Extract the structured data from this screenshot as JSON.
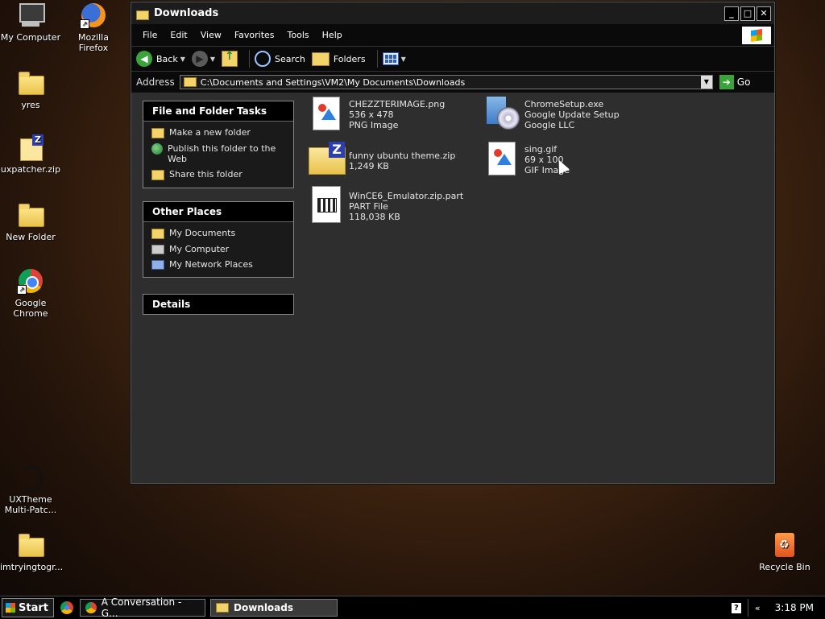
{
  "desktop": {
    "icons": [
      {
        "label": "My Computer"
      },
      {
        "label": "Mozilla Firefox"
      },
      {
        "label": "yres"
      },
      {
        "label": "uxpatcher.zip"
      },
      {
        "label": "New Folder"
      },
      {
        "label": "Google Chrome"
      },
      {
        "label": "UXTheme Multi-Patc..."
      },
      {
        "label": "imtryingtogr..."
      },
      {
        "label": "Recycle Bin"
      }
    ]
  },
  "window": {
    "title": "Downloads",
    "buttons": {
      "minimize": "_",
      "maximize": "□",
      "close": "✕"
    },
    "menu": [
      "File",
      "Edit",
      "View",
      "Favorites",
      "Tools",
      "Help"
    ],
    "toolbar": {
      "back": "Back",
      "search": "Search",
      "folders": "Folders"
    },
    "address": {
      "label": "Address",
      "path": "C:\\Documents and Settings\\VM2\\My Documents\\Downloads",
      "go": "Go"
    }
  },
  "tasks": {
    "file_folder": {
      "title": "File and Folder Tasks",
      "items": [
        "Make a new folder",
        "Publish this folder to the Web",
        "Share this folder"
      ]
    },
    "other_places": {
      "title": "Other Places",
      "items": [
        "My Documents",
        "My Computer",
        "My Network Places"
      ]
    },
    "details": {
      "title": "Details"
    }
  },
  "files": [
    {
      "name": "CHEZZTERIMAGE.png",
      "line2": "536 x 478",
      "line3": "PNG Image",
      "icon": "image-file-icon"
    },
    {
      "name": "ChromeSetup.exe",
      "line2": "Google Update Setup",
      "line3": "Google LLC",
      "icon": "installer-icon"
    },
    {
      "name": "funny ubuntu theme.zip",
      "line2": "1,249 KB",
      "line3": "",
      "icon": "zip-icon"
    },
    {
      "name": "sing.gif",
      "line2": "69 x 100",
      "line3": "GIF Image",
      "icon": "image-file-icon"
    },
    {
      "name": "WinCE6_Emulator.zip.part",
      "line2": "PART File",
      "line3": "118,038 KB",
      "icon": "part-file-icon"
    }
  ],
  "taskbar": {
    "start": "Start",
    "tasks": [
      {
        "label": "A Conversation - G..."
      },
      {
        "label": "Downloads"
      }
    ],
    "tray_arrow": "«",
    "help": "?",
    "clock": "3:18 PM"
  }
}
